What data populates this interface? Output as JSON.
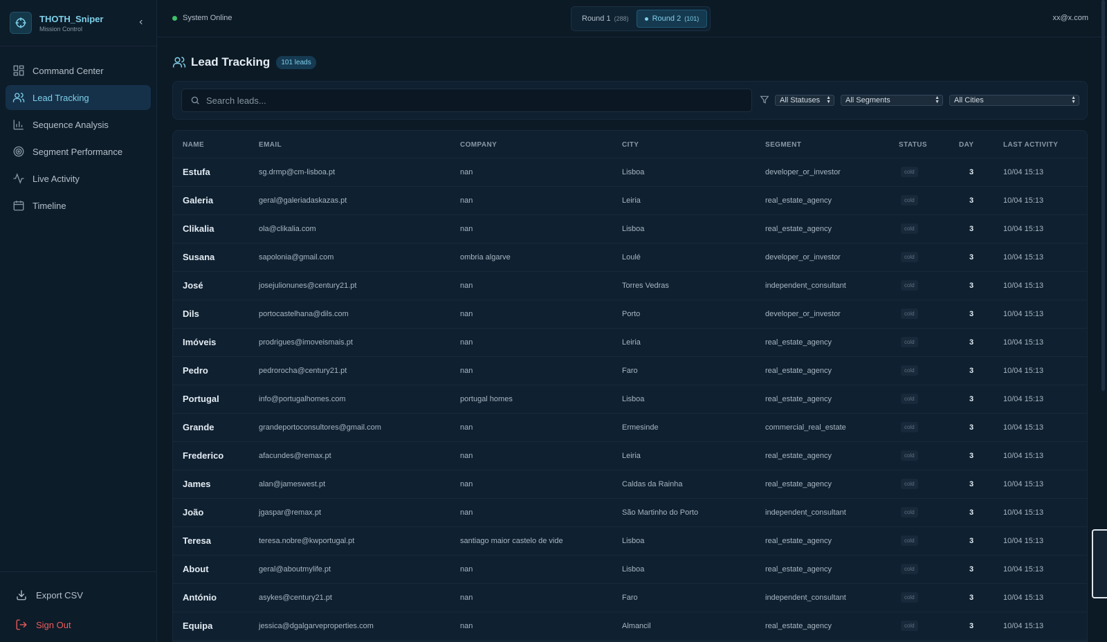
{
  "brand": {
    "title": "THOTH_Sniper",
    "subtitle": "Mission Control"
  },
  "nav": [
    {
      "label": "Command Center",
      "icon": "grid-icon",
      "active": false
    },
    {
      "label": "Lead Tracking",
      "icon": "users-icon",
      "active": true
    },
    {
      "label": "Sequence Analysis",
      "icon": "bar-chart-icon",
      "active": false
    },
    {
      "label": "Segment Performance",
      "icon": "target-icon",
      "active": false
    },
    {
      "label": "Live Activity",
      "icon": "activity-icon",
      "active": false
    },
    {
      "label": "Timeline",
      "icon": "calendar-icon",
      "active": false
    }
  ],
  "bottom": {
    "export_label": "Export CSV",
    "signout_label": "Sign Out"
  },
  "topbar": {
    "status": "System Online",
    "round1_label": "Round 1",
    "round1_count": "(288)",
    "round2_label": "Round 2",
    "round2_count": "(101)",
    "user": "xx@x.com"
  },
  "page": {
    "title": "Lead Tracking",
    "badge": "101 leads"
  },
  "filters": {
    "search_placeholder": "Search leads...",
    "status": "All Statuses",
    "segment": "All Segments",
    "city": "All Cities"
  },
  "table": {
    "headers": {
      "name": "NAME",
      "email": "EMAIL",
      "company": "COMPANY",
      "city": "CITY",
      "segment": "SEGMENT",
      "status": "STATUS",
      "day": "DAY",
      "activity": "LAST ACTIVITY"
    },
    "rows": [
      {
        "name": "Estufa",
        "email": "sg.drmp@cm-lisboa.pt",
        "company": "nan",
        "city": "Lisboa",
        "segment": "developer_or_investor",
        "status": "cold",
        "day": "3",
        "activity": "10/04 15:13"
      },
      {
        "name": "Galeria",
        "email": "geral@galeriadaskazas.pt",
        "company": "nan",
        "city": "Leiria",
        "segment": "real_estate_agency",
        "status": "cold",
        "day": "3",
        "activity": "10/04 15:13"
      },
      {
        "name": "Clikalia",
        "email": "ola@clikalia.com",
        "company": "nan",
        "city": "Lisboa",
        "segment": "real_estate_agency",
        "status": "cold",
        "day": "3",
        "activity": "10/04 15:13"
      },
      {
        "name": "Susana",
        "email": "sapolonia@gmail.com",
        "company": "ombria algarve",
        "city": "Loulé",
        "segment": "developer_or_investor",
        "status": "cold",
        "day": "3",
        "activity": "10/04 15:13"
      },
      {
        "name": "José",
        "email": "josejulionunes@century21.pt",
        "company": "nan",
        "city": "Torres Vedras",
        "segment": "independent_consultant",
        "status": "cold",
        "day": "3",
        "activity": "10/04 15:13"
      },
      {
        "name": "Dils",
        "email": "portocastelhana@dils.com",
        "company": "nan",
        "city": "Porto",
        "segment": "developer_or_investor",
        "status": "cold",
        "day": "3",
        "activity": "10/04 15:13"
      },
      {
        "name": "Imóveis",
        "email": "prodrigues@imoveismais.pt",
        "company": "nan",
        "city": "Leiria",
        "segment": "real_estate_agency",
        "status": "cold",
        "day": "3",
        "activity": "10/04 15:13"
      },
      {
        "name": "Pedro",
        "email": "pedrorocha@century21.pt",
        "company": "nan",
        "city": "Faro",
        "segment": "real_estate_agency",
        "status": "cold",
        "day": "3",
        "activity": "10/04 15:13"
      },
      {
        "name": "Portugal",
        "email": "info@portugalhomes.com",
        "company": "portugal homes",
        "city": "Lisboa",
        "segment": "real_estate_agency",
        "status": "cold",
        "day": "3",
        "activity": "10/04 15:13"
      },
      {
        "name": "Grande",
        "email": "grandeportoconsultores@gmail.com",
        "company": "nan",
        "city": "Ermesinde",
        "segment": "commercial_real_estate",
        "status": "cold",
        "day": "3",
        "activity": "10/04 15:13"
      },
      {
        "name": "Frederico",
        "email": "afacundes@remax.pt",
        "company": "nan",
        "city": "Leiria",
        "segment": "real_estate_agency",
        "status": "cold",
        "day": "3",
        "activity": "10/04 15:13"
      },
      {
        "name": "James",
        "email": "alan@jameswest.pt",
        "company": "nan",
        "city": "Caldas da Rainha",
        "segment": "real_estate_agency",
        "status": "cold",
        "day": "3",
        "activity": "10/04 15:13"
      },
      {
        "name": "João",
        "email": "jgaspar@remax.pt",
        "company": "nan",
        "city": "São Martinho do Porto",
        "segment": "independent_consultant",
        "status": "cold",
        "day": "3",
        "activity": "10/04 15:13"
      },
      {
        "name": "Teresa",
        "email": "teresa.nobre@kwportugal.pt",
        "company": "santiago maior castelo de vide",
        "city": "Lisboa",
        "segment": "real_estate_agency",
        "status": "cold",
        "day": "3",
        "activity": "10/04 15:13"
      },
      {
        "name": "About",
        "email": "geral@aboutmylife.pt",
        "company": "nan",
        "city": "Lisboa",
        "segment": "real_estate_agency",
        "status": "cold",
        "day": "3",
        "activity": "10/04 15:13"
      },
      {
        "name": "António",
        "email": "asykes@century21.pt",
        "company": "nan",
        "city": "Faro",
        "segment": "independent_consultant",
        "status": "cold",
        "day": "3",
        "activity": "10/04 15:13"
      },
      {
        "name": "Equipa",
        "email": "jessica@dgalgarveproperties.com",
        "company": "nan",
        "city": "Almancil",
        "segment": "real_estate_agency",
        "status": "cold",
        "day": "3",
        "activity": "10/04 15:13"
      }
    ]
  }
}
